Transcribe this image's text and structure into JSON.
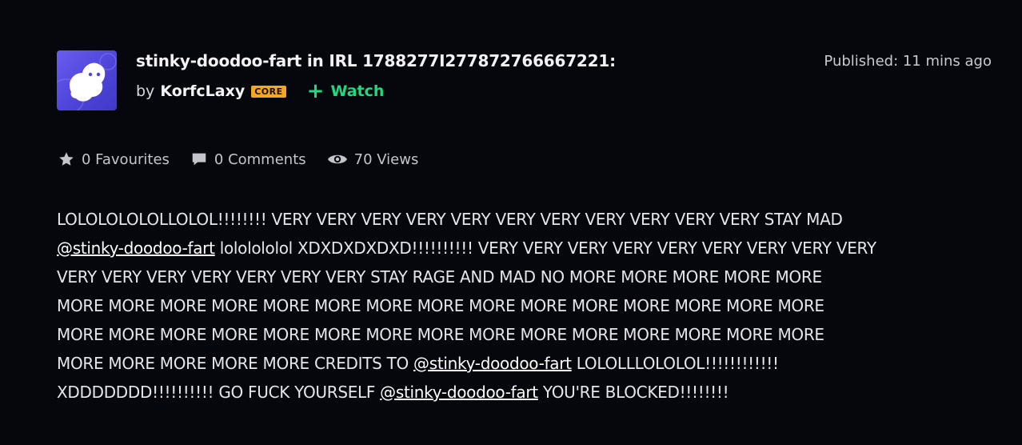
{
  "deviation": {
    "title": "stinky-doodoo-fart in IRL 1788277I277872766667221:",
    "by_label": "by",
    "author": "KorfcLaxy",
    "badge": "CORE",
    "watch_label": "Watch",
    "published": "Published: 11 mins ago"
  },
  "stats": {
    "favourites": "0 Favourites",
    "comments": "0 Comments",
    "views": "70 Views"
  },
  "body": {
    "seg1": "LOLOLOLOLOLLOLOL!!!!!!!! VERY VERY VERY VERY VERY VERY VERY VERY VERY VERY VERY STAY MAD\n",
    "mention1": "@stinky-doodoo-fart",
    "seg2": " lololololol XDXDXDXDXD!!!!!!!!!! VERY VERY VERY VERY VERY VERY VERY VERY VERY\nVERY VERY VERY VERY VERY VERY VERY STAY RAGE AND MAD NO MORE MORE MORE MORE MORE\nMORE MORE MORE MORE MORE MORE MORE MORE MORE MORE MORE MORE MORE MORE MORE\nMORE MORE MORE MORE MORE MORE MORE MORE MORE MORE MORE MORE MORE MORE MORE\nMORE MORE MORE MORE MORE CREDITS TO ",
    "mention2": "@stinky-doodoo-fart",
    "seg3": " LOLOLLLOLOLOL!!!!!!!!!!!!\nXDDDDDDD!!!!!!!!!! GO FUCK YOURSELF ",
    "mention3": "@stinky-doodoo-fart",
    "seg4": " YOU'RE BLOCKED!!!!!!!!"
  },
  "icons": {
    "favourite": "star-icon",
    "comment": "comment-bubble-icon",
    "views": "eye-icon",
    "watch": "plus-icon"
  },
  "colors": {
    "background": "#06070d",
    "watch": "#1fd87f",
    "badge": "#f5a623",
    "avatar": "#5b4fe6"
  }
}
